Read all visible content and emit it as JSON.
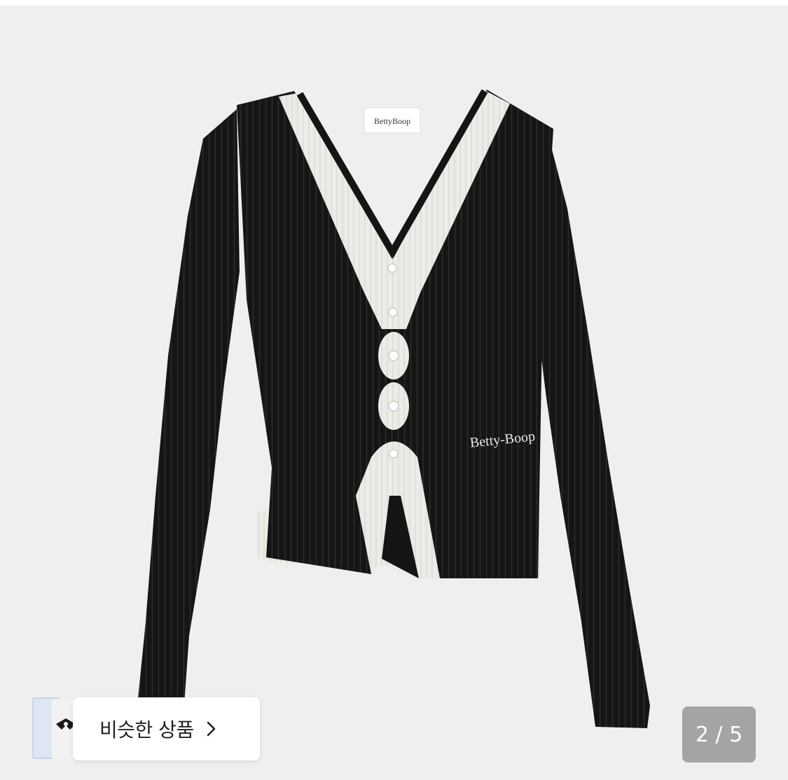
{
  "gallery": {
    "image_label_small": "BettyBoop",
    "image_label_embroidery": "Betty-Boop",
    "page_indicator": "2 / 5"
  },
  "similar_products": {
    "label": "비슷한 상품"
  },
  "colors": {
    "background": "#efefef",
    "garment": "#151515",
    "trim": "#ecebe6",
    "indicator_bg": "#878787"
  }
}
